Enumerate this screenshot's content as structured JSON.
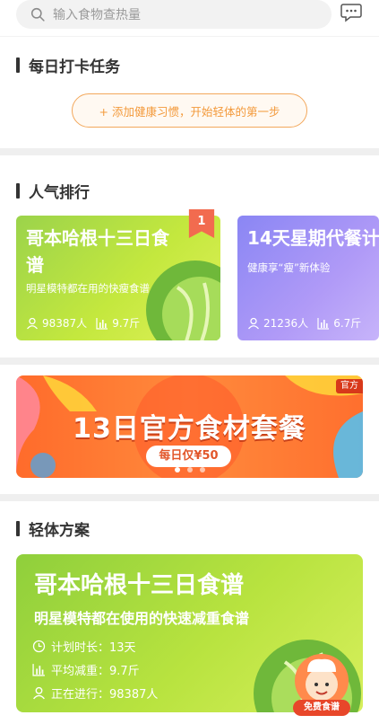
{
  "search": {
    "placeholder": "输入食物查热量"
  },
  "icons": {
    "search": "search-icon",
    "message": "message-icon",
    "person": "person-icon",
    "chart": "bar-chart-icon",
    "clock": "clock-icon"
  },
  "daily": {
    "title": "每日打卡任务",
    "habit_button": "+ 添加健康习惯，开始轻体的第一步"
  },
  "ranking": {
    "title": "人气排行",
    "cards": [
      {
        "rank": "1",
        "title": "哥本哈根十三日食谱",
        "subtitle": "明星模特都在用的快瘦食谱",
        "participants": "98387人",
        "loss": "9.7斤"
      },
      {
        "title": "14天星期代餐计",
        "subtitle": "健康享“瘦”新体验",
        "participants": "21236人",
        "loss": "6.7斤"
      }
    ]
  },
  "banner": {
    "title": "13日官方食材套餐",
    "price": "每日仅¥50",
    "tag": "官方",
    "active_index": 0,
    "count": 3
  },
  "plan": {
    "title": "轻体方案",
    "card_title": "哥本哈根十三日食谱",
    "card_subtitle": "明星模特都在使用的快速减重食谱",
    "duration": "计划时长：13天",
    "avg_loss": "平均减重：9.7斤",
    "ongoing": "正在进行：98387人",
    "free_label": "免费食谱"
  },
  "colors": {
    "accent_orange": "#f39a3c",
    "green_card": "#a9dc45",
    "purple_card": "#9a8ff5",
    "banner_orange": "#ff7a34"
  }
}
